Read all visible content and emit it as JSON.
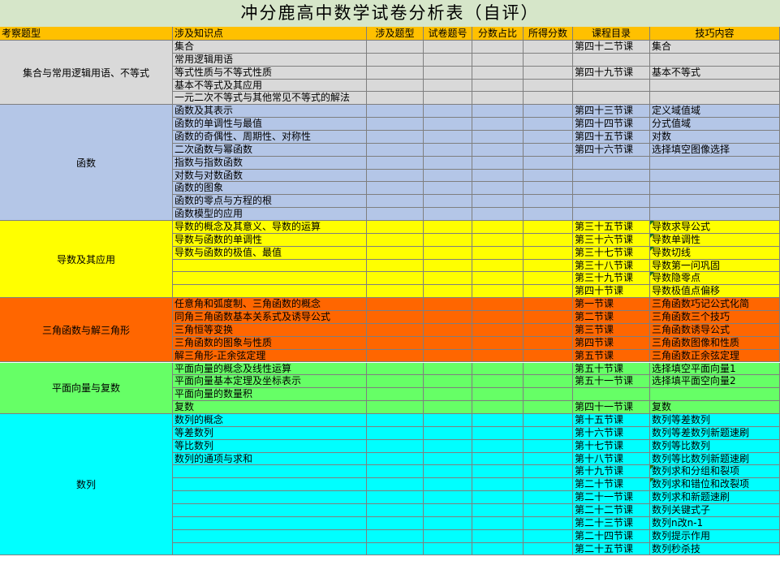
{
  "title": "冲分鹿高中数学试卷分析表（自评）",
  "headers": [
    "考察题型",
    "涉及知识点",
    "涉及题型",
    "试卷题号",
    "分数占比",
    "所得分数",
    "课程目录",
    "技巧内容"
  ],
  "groups": [
    {
      "name": "集合与常用逻辑用语、不等式",
      "color": "#d9d9d9",
      "rows": [
        {
          "k": "集合",
          "c": "第四十二节课",
          "t": "集合"
        },
        {
          "k": "常用逻辑用语",
          "c": "",
          "t": ""
        },
        {
          "k": "等式性质与不等式性质",
          "c": "第四十九节课",
          "t": "基本不等式"
        },
        {
          "k": "基本不等式及其应用",
          "c": "",
          "t": ""
        },
        {
          "k": "一元二次不等式与其他常见不等式的解法",
          "c": "",
          "t": ""
        }
      ]
    },
    {
      "name": "函数",
      "color": "#b4c6e7",
      "rows": [
        {
          "k": "函数及其表示",
          "c": "第四十三节课",
          "t": "定义域值域"
        },
        {
          "k": "函数的单调性与最值",
          "c": "第四十四节课",
          "t": "分式值域"
        },
        {
          "k": "函数的奇偶性、周期性、对称性",
          "c": "第四十五节课",
          "t": "对数"
        },
        {
          "k": "二次函数与幂函数",
          "c": "第四十六节课",
          "t": "选择填空图像选择"
        },
        {
          "k": "指数与指数函数",
          "c": "",
          "t": ""
        },
        {
          "k": "对数与对数函数",
          "c": "",
          "t": ""
        },
        {
          "k": "函数的图象",
          "c": "",
          "t": ""
        },
        {
          "k": "函数的零点与方程的根",
          "c": "",
          "t": ""
        },
        {
          "k": "函数模型的应用",
          "c": "",
          "t": ""
        }
      ]
    },
    {
      "name": "导数及其应用",
      "color": "#ffff00",
      "rows": [
        {
          "k": "导数的概念及其意义、导数的运算",
          "c": "第三十五节课",
          "t": "导数求导公式",
          "f": true
        },
        {
          "k": "导数与函数的单调性",
          "c": "第三十六节课",
          "t": "导数单调性",
          "f": true
        },
        {
          "k": "导数与函数的极值、最值",
          "c": "第三十七节课",
          "t": "导数切线",
          "f": true
        },
        {
          "k": "",
          "c": "第三十八节课",
          "t": "导数第一问巩固"
        },
        {
          "k": "",
          "c": "第三十九节课",
          "t": "导数隐零点",
          "f": true
        },
        {
          "k": "",
          "c": "第四十节课",
          "t": "导数极值点偏移"
        }
      ]
    },
    {
      "name": "三角函数与解三角形",
      "color": "#ff6600",
      "rows": [
        {
          "k": "任意角和弧度制、三角函数的概念",
          "c": "第一节课",
          "t": "三角函数巧记公式化简"
        },
        {
          "k": "同角三角函数基本关系式及诱导公式",
          "c": "第二节课",
          "t": "三角函数三个技巧"
        },
        {
          "k": "三角恒等变换",
          "c": "第三节课",
          "t": "三角函数诱导公式"
        },
        {
          "k": "三角函数的图象与性质",
          "c": "第四节课",
          "t": "三角函数图像和性质"
        },
        {
          "k": "解三角形-正余弦定理",
          "c": "第五节课",
          "t": "三角函数正余弦定理"
        }
      ]
    },
    {
      "name": "平面向量与复数",
      "color": "#66ff66",
      "rows": [
        {
          "k": "平面向量的概念及线性运算",
          "c": "第五十节课",
          "t": "选择填空平面向量1"
        },
        {
          "k": "平面向量基本定理及坐标表示",
          "c": "第五十一节课",
          "t": "选择填平面空向量2"
        },
        {
          "k": "平面向量的数量积",
          "c": "",
          "t": ""
        },
        {
          "k": "复数",
          "c": "第四十一节课",
          "t": "复数"
        }
      ]
    },
    {
      "name": "数列",
      "color": "#00ffff",
      "rows": [
        {
          "k": "数列的概念",
          "c": "第十五节课",
          "t": "数列等差数列"
        },
        {
          "k": "等差数列",
          "c": "第十六节课",
          "t": "数列等差数列新题速刷"
        },
        {
          "k": "等比数列",
          "c": "第十七节课",
          "t": "数列等比数列"
        },
        {
          "k": "数列的通项与求和",
          "c": "第十八节课",
          "t": "数列等比数列新题速刷"
        },
        {
          "k": "",
          "c": "第十九节课",
          "t": "数列求和分组和裂项",
          "f": true
        },
        {
          "k": "",
          "c": "第二十节课",
          "t": "数列求和错位和改裂项",
          "f": true
        },
        {
          "k": "",
          "c": "第二十一节课",
          "t": "数列求和新题速刷"
        },
        {
          "k": "",
          "c": "第二十二节课",
          "t": "数列关键式子"
        },
        {
          "k": "",
          "c": "第二十三节课",
          "t": "数列n改n-1"
        },
        {
          "k": "",
          "c": "第二十四节课",
          "t": "数列提示作用"
        },
        {
          "k": "",
          "c": "第二十五节课",
          "t": "数列秒杀技"
        }
      ]
    }
  ]
}
